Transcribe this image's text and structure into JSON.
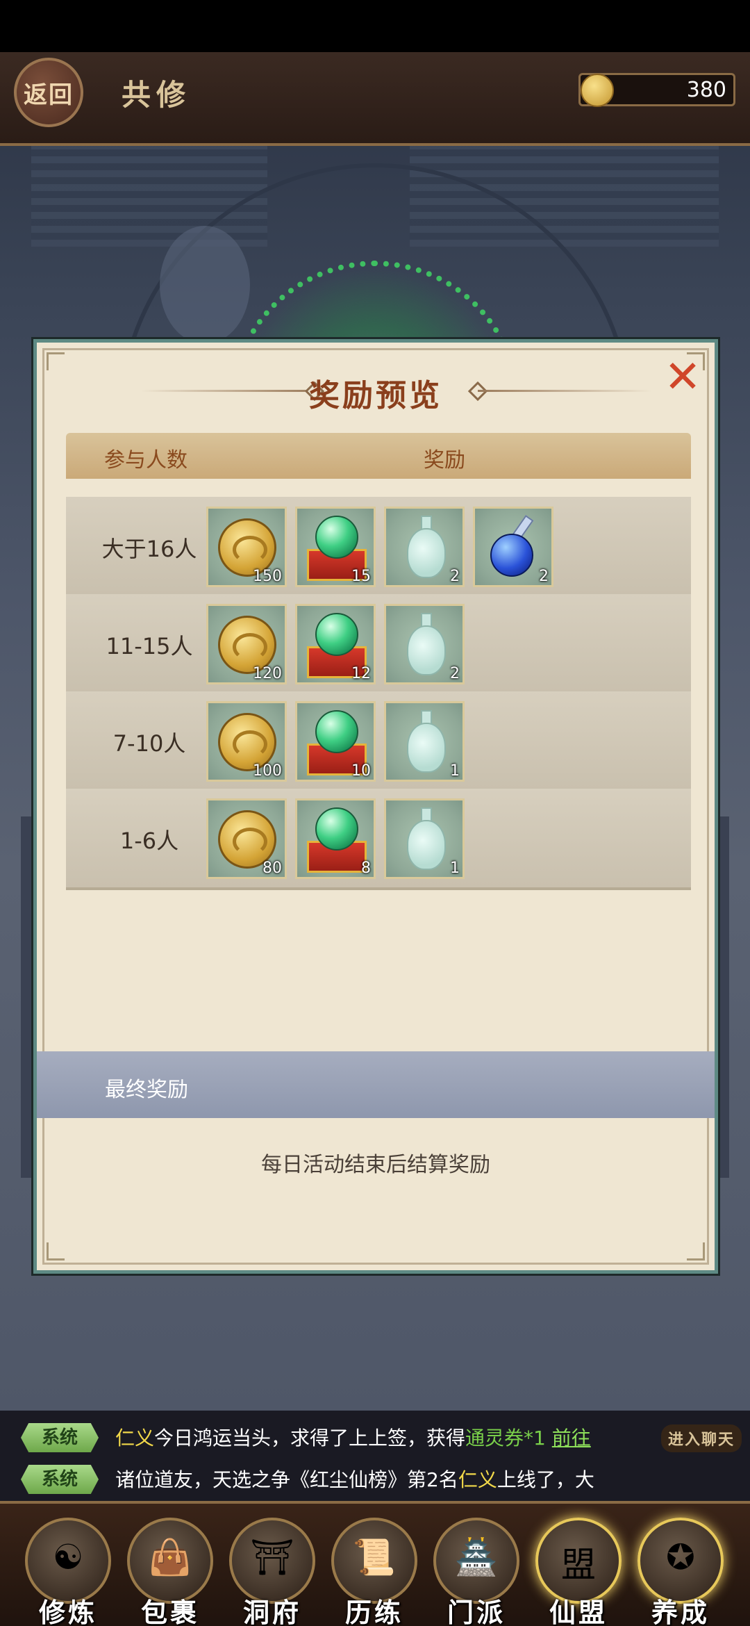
{
  "header": {
    "back_label": "返回",
    "title": "共修",
    "currency_value": "380",
    "currency_icon": "gold-coin-icon"
  },
  "modal": {
    "title": "奖励预览",
    "close_icon": "close-x-icon",
    "columns": [
      "参与人数",
      "奖励"
    ],
    "rows": [
      {
        "label": "大于16人",
        "rewards": [
          {
            "type": "coin",
            "qty": "150"
          },
          {
            "type": "orb",
            "qty": "15"
          },
          {
            "type": "bottle",
            "qty": "2"
          },
          {
            "type": "potion",
            "qty": "2"
          }
        ]
      },
      {
        "label": "11-15人",
        "rewards": [
          {
            "type": "coin",
            "qty": "120"
          },
          {
            "type": "orb",
            "qty": "12"
          },
          {
            "type": "bottle",
            "qty": "2"
          }
        ]
      },
      {
        "label": "7-10人",
        "rewards": [
          {
            "type": "coin",
            "qty": "100"
          },
          {
            "type": "orb",
            "qty": "10"
          },
          {
            "type": "bottle",
            "qty": "1"
          }
        ]
      },
      {
        "label": "1-6人",
        "rewards": [
          {
            "type": "coin",
            "qty": "80"
          },
          {
            "type": "orb",
            "qty": "8"
          },
          {
            "type": "bottle",
            "qty": "1"
          }
        ]
      }
    ],
    "final_reward_label": "最终奖励",
    "settle_note": "每日活动结束后结算奖励"
  },
  "chat": {
    "tag": "系统",
    "line1": {
      "name": "仁义",
      "text": "今日鸿运当头，求得了上上签，获得",
      "item": "通灵券*1",
      "link": "前往"
    },
    "line2": {
      "prefix": "诸位道友，天选之争《红尘仙榜》第2名",
      "name": "仁义",
      "suffix": "上线了，大"
    },
    "enter_label": "进入聊天"
  },
  "nav": [
    {
      "label": "修炼",
      "icon": "cultivator-icon",
      "glyph": "☯"
    },
    {
      "label": "包裹",
      "icon": "bag-icon",
      "glyph": "👜"
    },
    {
      "label": "洞府",
      "icon": "cave-dwelling-icon",
      "glyph": "⛩"
    },
    {
      "label": "历练",
      "icon": "scroll-icon",
      "glyph": "📜"
    },
    {
      "label": "门派",
      "icon": "sect-gate-icon",
      "glyph": "🏯"
    },
    {
      "label": "仙盟",
      "icon": "alliance-icon",
      "glyph": "盟"
    },
    {
      "label": "养成",
      "icon": "pentagram-icon",
      "glyph": "✪"
    }
  ]
}
